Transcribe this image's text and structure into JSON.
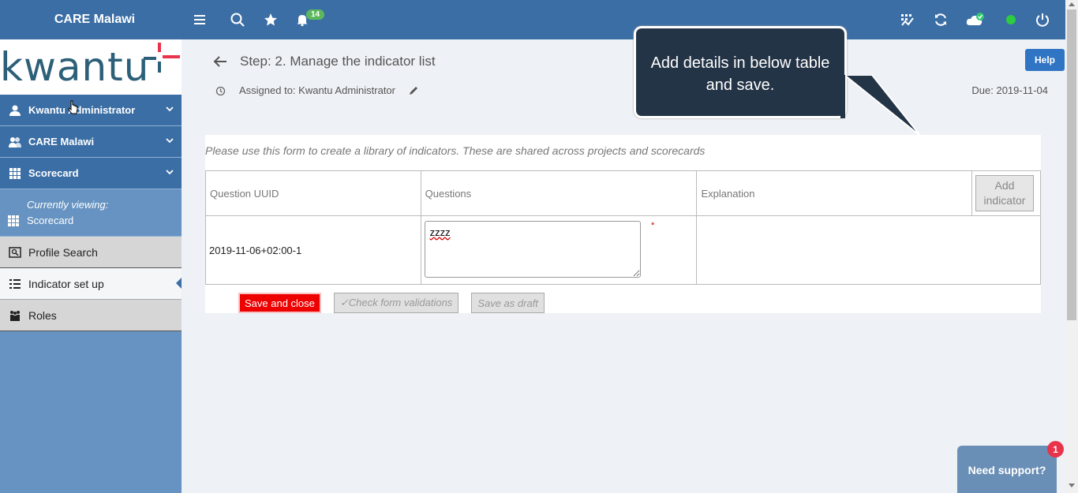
{
  "header": {
    "brand": "CARE Malawi",
    "notification_count": "14",
    "colors": {
      "bar": "#3b6ea5",
      "online": "#2ecc40"
    }
  },
  "logo": {
    "text": "kwantu"
  },
  "sidebar": {
    "items": [
      {
        "label": "Kwantu Administrator",
        "icon": "user-icon"
      },
      {
        "label": "CARE Malawi",
        "icon": "users-icon"
      },
      {
        "label": "Scorecard",
        "icon": "grid-icon"
      }
    ],
    "viewing": {
      "caption": "Currently viewing:",
      "value": "Scorecard",
      "icon": "grid-icon"
    },
    "nav": [
      {
        "label": "Profile Search",
        "icon": "profile-search-icon"
      },
      {
        "label": "Indicator set up",
        "icon": "list-icon"
      },
      {
        "label": "Roles",
        "icon": "people-icon"
      }
    ]
  },
  "step": {
    "title": "Step: 2. Manage the indicator list",
    "assigned": "Assigned to: Kwantu Administrator",
    "due": "Due: 2019-11-04",
    "help_label": "Help"
  },
  "tooltip": {
    "text": "Add details in below table and save."
  },
  "form": {
    "instructions": "Please use this form to create a library of indicators. These are shared across projects and scorecards",
    "columns": [
      "Question UUID",
      "Questions",
      "Explanation"
    ],
    "add_label": "Add indicator",
    "rows": [
      {
        "uuid": "2019-11-06+02:00-1",
        "question": "zzzz",
        "explanation": ""
      }
    ],
    "required_mark": "*",
    "buttons": {
      "save_close": "Save and close",
      "check": "✓Check form validations",
      "draft": "Save as draft"
    }
  },
  "support": {
    "label": "Need support?",
    "badge": "1"
  }
}
